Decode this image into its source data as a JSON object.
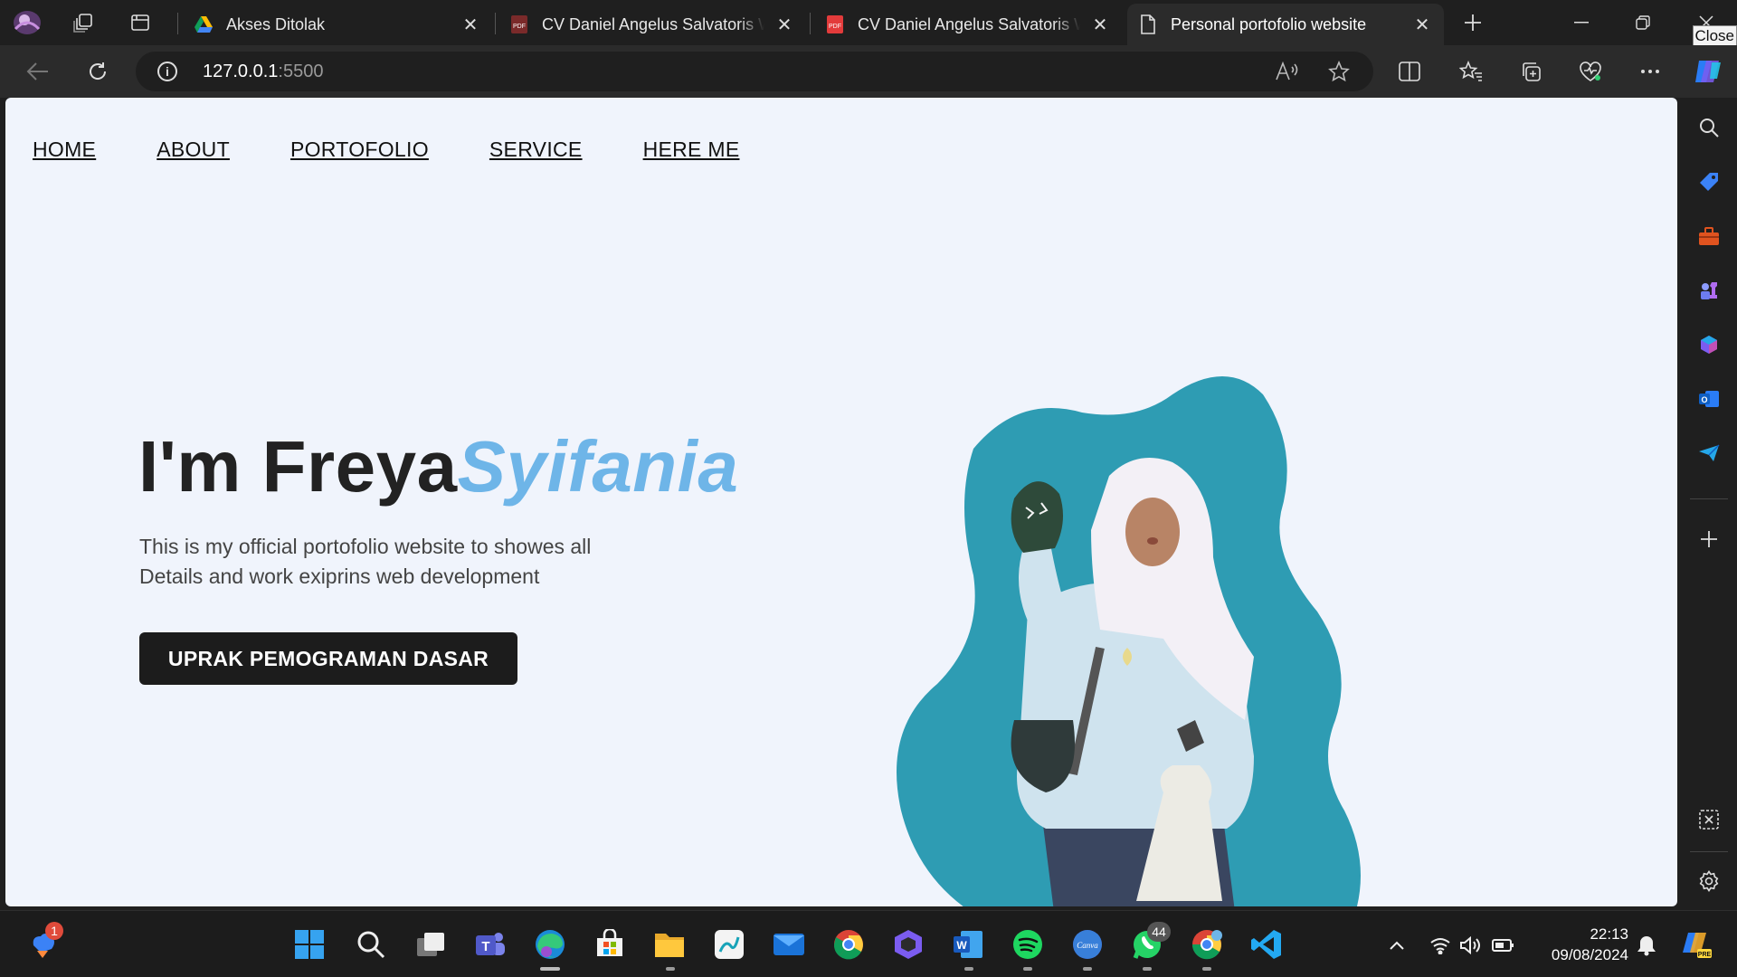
{
  "browser": {
    "tabs": [
      {
        "title": "Akses Ditolak",
        "favicon": "google-drive-icon"
      },
      {
        "title": "CV Daniel Angelus Salvatoris Wardhana",
        "favicon": "pdf-icon"
      },
      {
        "title": "CV Daniel Angelus Salvatoris Wardhana",
        "favicon": "pdf-icon"
      },
      {
        "title": "Personal portofolio website",
        "favicon": "page-icon",
        "active": true
      }
    ],
    "close_tooltip": "Close",
    "url_host": "127.0.0.1",
    "url_port": ":5500"
  },
  "page": {
    "nav": [
      "HOME",
      "ABOUT",
      "PORTOFOLIO",
      "SERVICE",
      "HERE ME"
    ],
    "hero": {
      "name_prefix": "I'm Freya",
      "name_accent": "Syifania",
      "description_line1": "This is my official portofolio website to showes all",
      "description_line2": "Details and work exiprins web development",
      "cta_label": "UPRAK PEMOGRAMAN DASAR"
    },
    "accent_color": "#6eb5e8",
    "blob_color": "#2e9cb3"
  },
  "taskbar": {
    "weather_badge": "1",
    "whatsapp_badge": "44",
    "time": "22:13",
    "date": "09/08/2024"
  }
}
